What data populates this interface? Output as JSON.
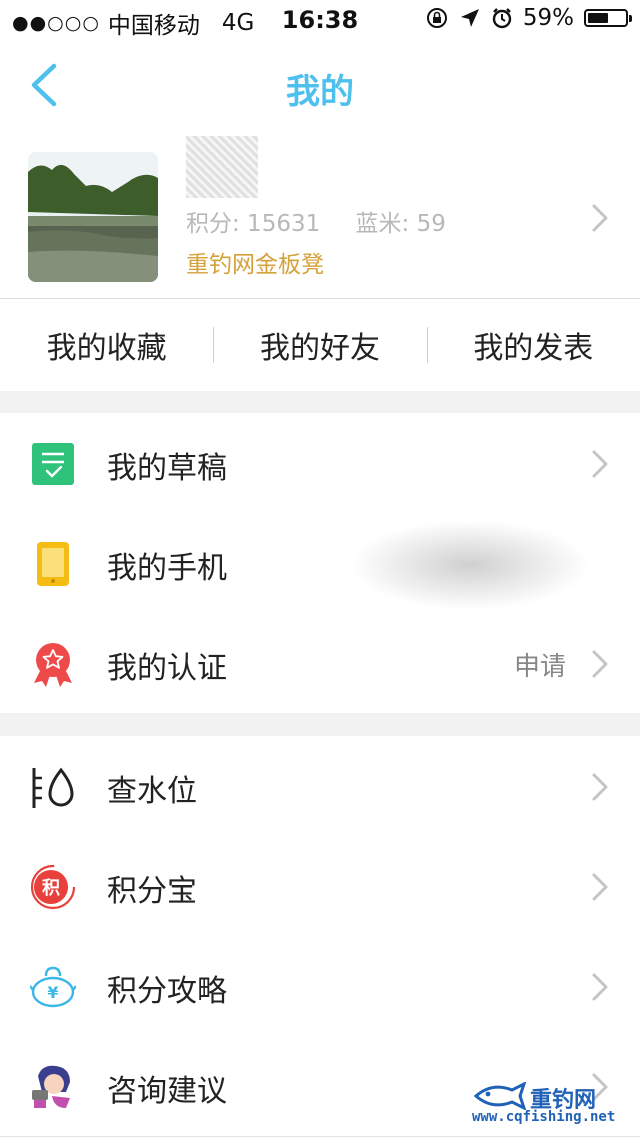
{
  "status_bar": {
    "signal_dots": "●●○○○",
    "carrier": "中国移动",
    "network": "4G",
    "time": "16:38",
    "battery": "59%",
    "battery_level": 0.59
  },
  "navbar": {
    "title": "我的"
  },
  "profile": {
    "points_label": "积分: 15631",
    "lanmi_label": "蓝米: 59",
    "level": "重钓网金板凳"
  },
  "tabs": [
    {
      "label": "我的收藏"
    },
    {
      "label": "我的好友"
    },
    {
      "label": "我的发表"
    }
  ],
  "menu": [
    {
      "label": "我的草稿",
      "icon": "draft-icon",
      "color": "#2fc27a"
    },
    {
      "label": "我的手机",
      "icon": "phone-icon",
      "color": "#f5bd14"
    },
    {
      "label": "我的认证",
      "icon": "certification-badge-icon",
      "extra": "申请",
      "color": "#ef4a4a"
    },
    {
      "label": "查水位",
      "icon": "water-level-icon",
      "color": "#222222"
    },
    {
      "label": "积分宝",
      "icon": "points-treasure-icon",
      "badge": "积",
      "color": "#e8413b"
    },
    {
      "label": "积分攻略",
      "icon": "points-guide-icon",
      "badge": "¥",
      "color": "#3bb7e8"
    },
    {
      "label": "咨询建议",
      "icon": "advice-avatar-icon"
    }
  ],
  "watermark": {
    "brand": "重钓网",
    "url": "www.cqfishing.net"
  },
  "colors": {
    "accent": "#4ec0ee",
    "gold": "#d4a13a",
    "background_gap": "#f2f2f2"
  }
}
